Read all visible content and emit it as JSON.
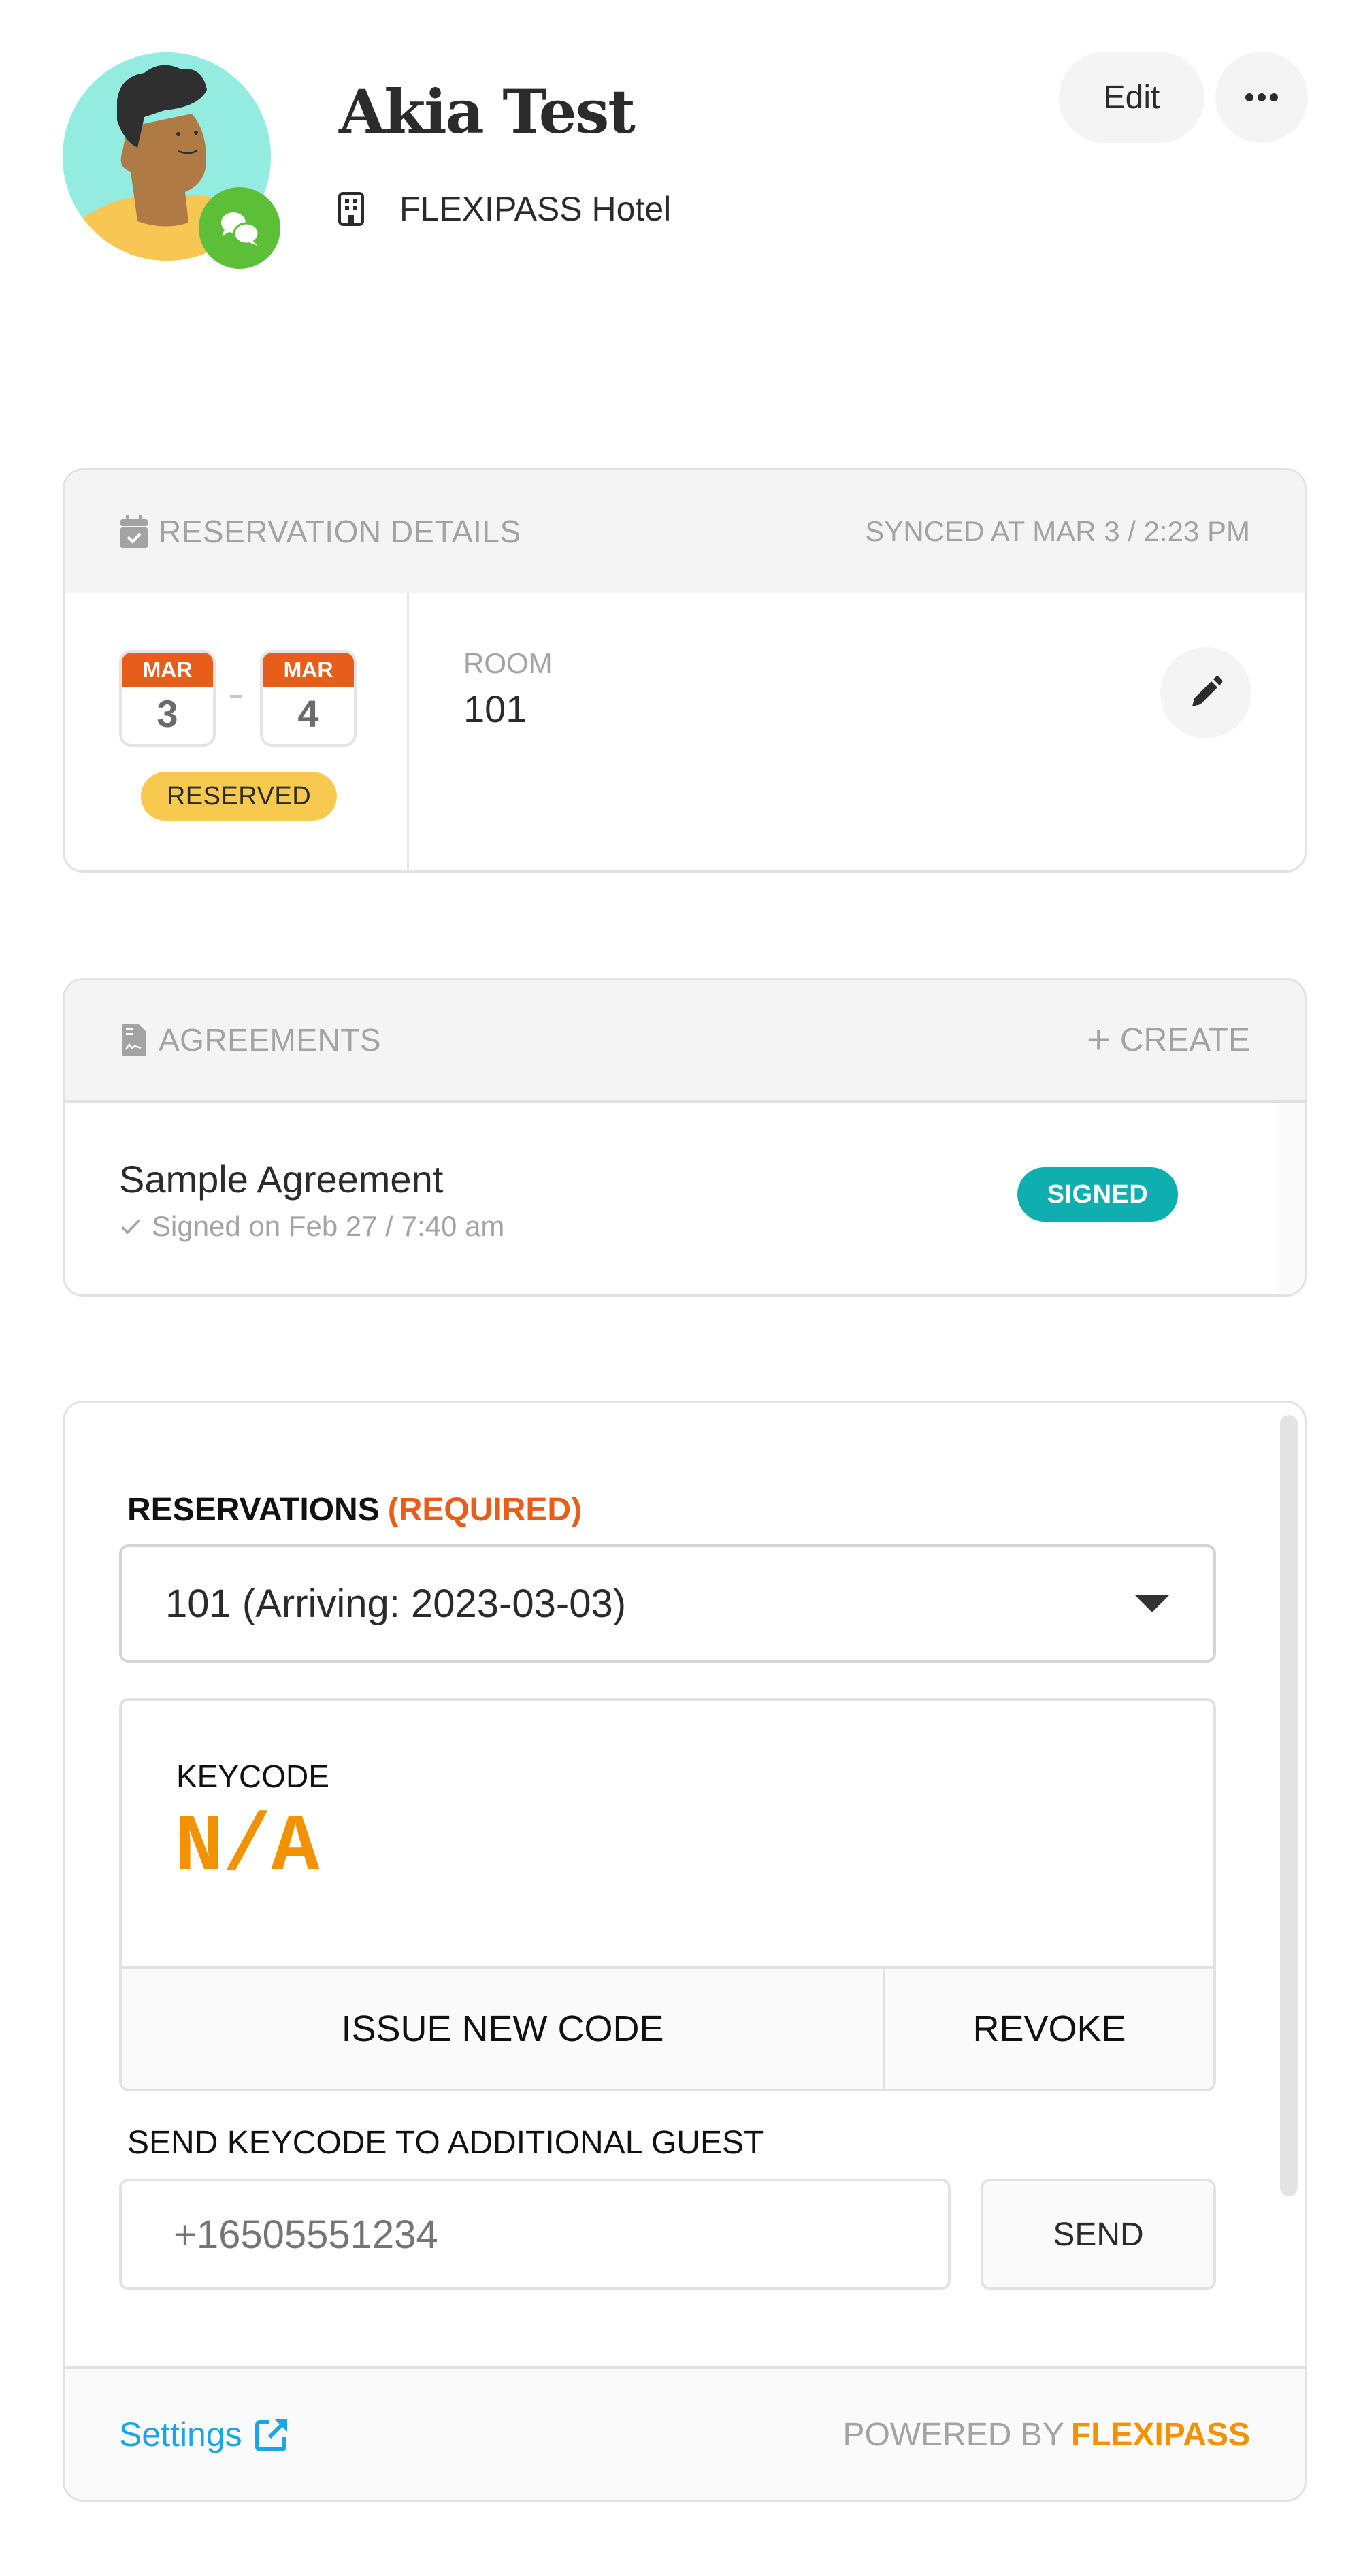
{
  "header": {
    "guest_name": "Akia Test",
    "hotel_name": "FLEXIPASS Hotel",
    "edit_label": "Edit",
    "more_icon": "more-horizontal-icon",
    "avatar_badge_icon": "chat-bubbles-icon",
    "hotel_icon": "building-icon"
  },
  "reservation_details": {
    "title": "RESERVATION DETAILS",
    "icon": "calendar-check-icon",
    "synced_text": "SYNCED AT MAR 3 / 2:23 PM",
    "check_in": {
      "month": "MAR",
      "day": "3"
    },
    "check_out": {
      "month": "MAR",
      "day": "4"
    },
    "status": "RESERVED",
    "room_label": "ROOM",
    "room_value": "101",
    "edit_icon": "pencil-icon"
  },
  "agreements": {
    "title": "AGREEMENTS",
    "icon": "document-signature-icon",
    "create_label": "CREATE",
    "items": [
      {
        "name": "Sample Agreement",
        "signed_text": "Signed on Feb 27 / 7:40 am",
        "status": "SIGNED"
      }
    ]
  },
  "keycode_widget": {
    "reservations_label": "RESERVATIONS",
    "required_label": "(REQUIRED)",
    "selected_reservation": "101 (Arriving: 2023-03-03)",
    "keycode_label": "KEYCODE",
    "keycode_value": "N/A",
    "issue_label": "ISSUE NEW CODE",
    "revoke_label": "REVOKE",
    "send_label": "SEND KEYCODE TO ADDITIONAL GUEST",
    "phone_placeholder": "+16505551234",
    "send_button": "SEND",
    "settings_label": "Settings",
    "powered_by": "POWERED BY",
    "brand": "FLEXIPASS"
  },
  "colors": {
    "accent_orange": "#e85d1a",
    "brand_orange": "#f39200",
    "status_reserved": "#f7c94f",
    "status_signed": "#0eafae",
    "link_blue": "#1aa6e6",
    "online_green": "#5cbf37"
  }
}
